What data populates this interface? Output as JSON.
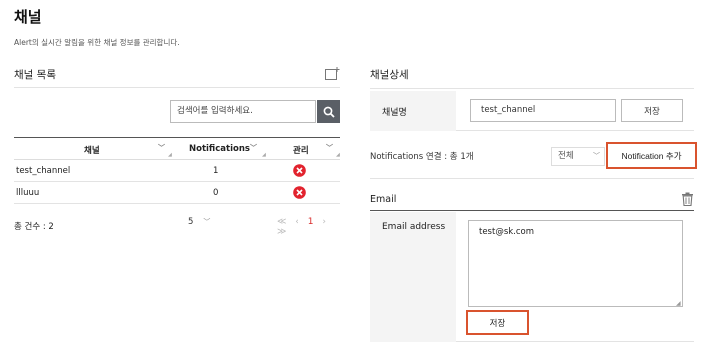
{
  "page": {
    "title": "채널",
    "description": "Alert의 실시간 알림을 위한 채널 정보를 관리합니다."
  },
  "list": {
    "title": "채널 목록",
    "search_placeholder": "검색어를 입력하세요.",
    "columns": [
      "채널",
      "Notifications",
      "관리"
    ],
    "rows": [
      {
        "channel": "test_channel",
        "notifications": "1"
      },
      {
        "channel": "llluuu",
        "notifications": "0"
      }
    ],
    "total_label": "총 건수 : 2",
    "page_size": "5",
    "current_page": "1",
    "pager_prev": "≪ ‹",
    "pager_next": "› ≫"
  },
  "detail": {
    "title": "채널상세",
    "name_label": "채널명",
    "name_value": "test_channel",
    "save_label": "저장",
    "notif_label": "Notifications 연결 : 총 1개",
    "notif_filter": "전체",
    "notif_add_label": "Notification 추가",
    "email_title": "Email",
    "address_label": "Email address",
    "address_value": "test@sk.com",
    "save2_label": "저장"
  },
  "colors": {
    "accent_red": "#d9532e",
    "delete_red": "#e2232e",
    "search_button": "#5a5f66"
  }
}
